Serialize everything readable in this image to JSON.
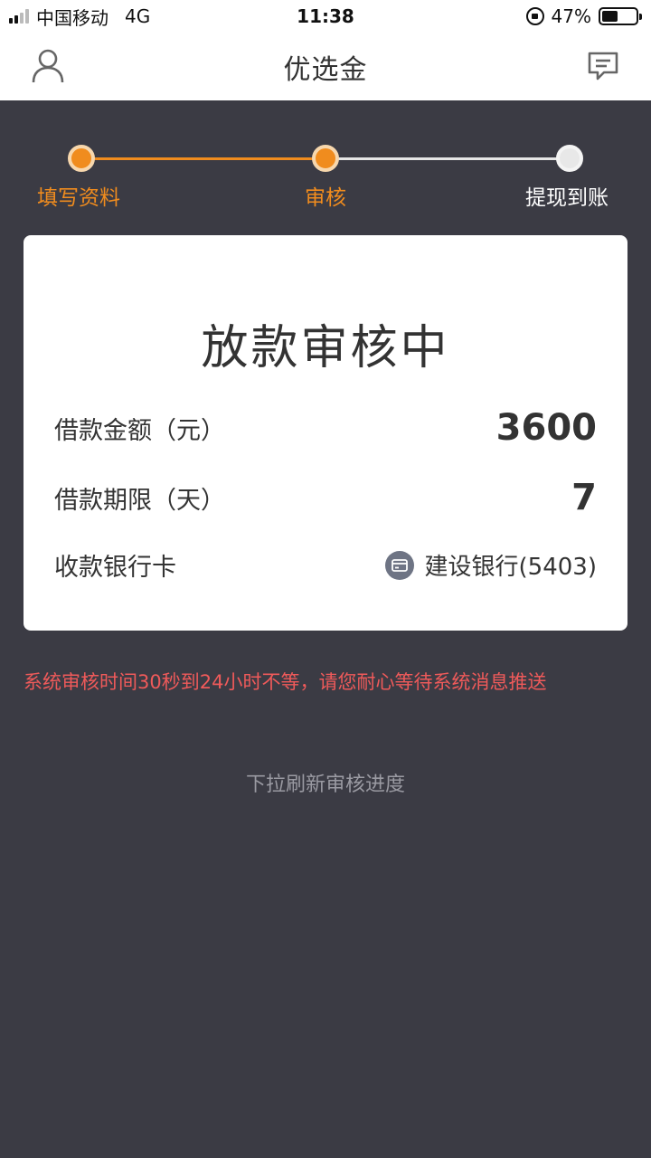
{
  "status_bar": {
    "carrier": "中国移动",
    "network": "4G",
    "time": "11:38",
    "battery_percent": "47%",
    "battery_level": 0.47
  },
  "nav": {
    "title": "优选金",
    "left_icon": "user-icon",
    "right_icon": "message-icon"
  },
  "steps": [
    {
      "label": "填写资料",
      "state": "done"
    },
    {
      "label": "审核",
      "state": "active"
    },
    {
      "label": "提现到账",
      "state": "pending"
    }
  ],
  "colors": {
    "accent": "#f08c1e",
    "background": "#3b3b44",
    "notice": "#ef5a5a"
  },
  "card": {
    "title": "放款审核中",
    "amount_label": "借款金额（元）",
    "amount_value": "3600",
    "term_label": "借款期限（天）",
    "term_value": "7",
    "bank_label": "收款银行卡",
    "bank_icon": "card-icon",
    "bank_value": "建设银行(5403)"
  },
  "notice": "系统审核时间30秒到24小时不等，请您耐心等待系统消息推送",
  "pull_hint": "下拉刷新审核进度"
}
